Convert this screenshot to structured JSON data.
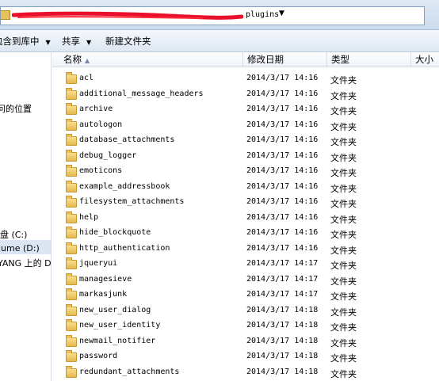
{
  "address_bar": {
    "current_folder": "plugins"
  },
  "toolbar": {
    "include_in_library_label": "包含到库中",
    "share_label": "共享",
    "new_folder_label": "新建文件夹"
  },
  "sidebar": {
    "items": [
      {
        "label": "问的位置"
      },
      {
        "label": "盘 (C:)"
      },
      {
        "label": "lume (D:)"
      },
      {
        "label": "YANG 上的 D"
      }
    ]
  },
  "columns": {
    "name": "名称",
    "date": "修改日期",
    "type": "类型",
    "size": "大小"
  },
  "files": [
    {
      "name": "acl",
      "date": "2014/3/17 14:16",
      "type": "文件夹"
    },
    {
      "name": "additional_message_headers",
      "date": "2014/3/17 14:16",
      "type": "文件夹"
    },
    {
      "name": "archive",
      "date": "2014/3/17 14:16",
      "type": "文件夹"
    },
    {
      "name": "autologon",
      "date": "2014/3/17 14:16",
      "type": "文件夹"
    },
    {
      "name": "database_attachments",
      "date": "2014/3/17 14:16",
      "type": "文件夹"
    },
    {
      "name": "debug_logger",
      "date": "2014/3/17 14:16",
      "type": "文件夹"
    },
    {
      "name": "emoticons",
      "date": "2014/3/17 14:16",
      "type": "文件夹"
    },
    {
      "name": "example_addressbook",
      "date": "2014/3/17 14:16",
      "type": "文件夹"
    },
    {
      "name": "filesystem_attachments",
      "date": "2014/3/17 14:16",
      "type": "文件夹"
    },
    {
      "name": "help",
      "date": "2014/3/17 14:16",
      "type": "文件夹"
    },
    {
      "name": "hide_blockquote",
      "date": "2014/3/17 14:16",
      "type": "文件夹"
    },
    {
      "name": "http_authentication",
      "date": "2014/3/17 14:16",
      "type": "文件夹"
    },
    {
      "name": "jqueryui",
      "date": "2014/3/17 14:17",
      "type": "文件夹"
    },
    {
      "name": "managesieve",
      "date": "2014/3/17 14:17",
      "type": "文件夹"
    },
    {
      "name": "markasjunk",
      "date": "2014/3/17 14:17",
      "type": "文件夹"
    },
    {
      "name": "new_user_dialog",
      "date": "2014/3/17 14:18",
      "type": "文件夹"
    },
    {
      "name": "new_user_identity",
      "date": "2014/3/17 14:18",
      "type": "文件夹"
    },
    {
      "name": "newmail_notifier",
      "date": "2014/3/17 14:18",
      "type": "文件夹"
    },
    {
      "name": "password",
      "date": "2014/3/17 14:18",
      "type": "文件夹"
    },
    {
      "name": "redundant_attachments",
      "date": "2014/3/17 14:18",
      "type": "文件夹"
    }
  ]
}
